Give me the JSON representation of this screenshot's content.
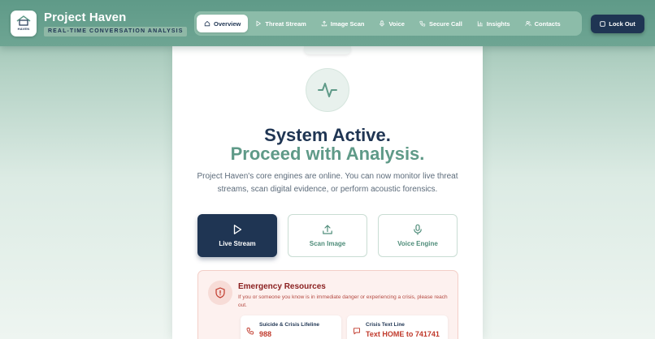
{
  "app": {
    "title": "Project Haven",
    "subtitle": "REAL-TIME CONVERSATION ANALYSIS",
    "logo_text": "HAVEN"
  },
  "nav": {
    "items": [
      {
        "label": "Overview",
        "icon": "home-icon",
        "active": true
      },
      {
        "label": "Threat Stream",
        "icon": "play-icon",
        "active": false
      },
      {
        "label": "Image Scan",
        "icon": "upload-icon",
        "active": false
      },
      {
        "label": "Voice",
        "icon": "mic-icon",
        "active": false
      },
      {
        "label": "Secure Call",
        "icon": "phone-icon",
        "active": false
      },
      {
        "label": "Insights",
        "icon": "chart-icon",
        "active": false
      },
      {
        "label": "Contacts",
        "icon": "users-icon",
        "active": false
      }
    ],
    "lock_label": "Lock Out"
  },
  "hero": {
    "heading_line1": "System Active.",
    "heading_line2": "Proceed with Analysis.",
    "description": "Project Haven's core engines are online. You can now monitor live threat streams, scan digital evidence, or perform acoustic forensics."
  },
  "actions": [
    {
      "label": "Live Stream",
      "icon": "play-icon"
    },
    {
      "label": "Scan Image",
      "icon": "upload-icon"
    },
    {
      "label": "Voice Engine",
      "icon": "mic-icon"
    }
  ],
  "emergency": {
    "title": "Emergency Resources",
    "text": "If you or someone you know is in immediate danger or experiencing a crisis, please reach out.",
    "resources": [
      {
        "label": "Suicide & Crisis Lifeline",
        "value": "988",
        "icon": "phone-icon"
      },
      {
        "label": "Crisis Text Line",
        "value": "Text HOME to 741741",
        "icon": "message-icon"
      }
    ]
  },
  "colors": {
    "navy": "#1f3553",
    "teal": "#5f9a88",
    "alert_red": "#c0392b"
  }
}
